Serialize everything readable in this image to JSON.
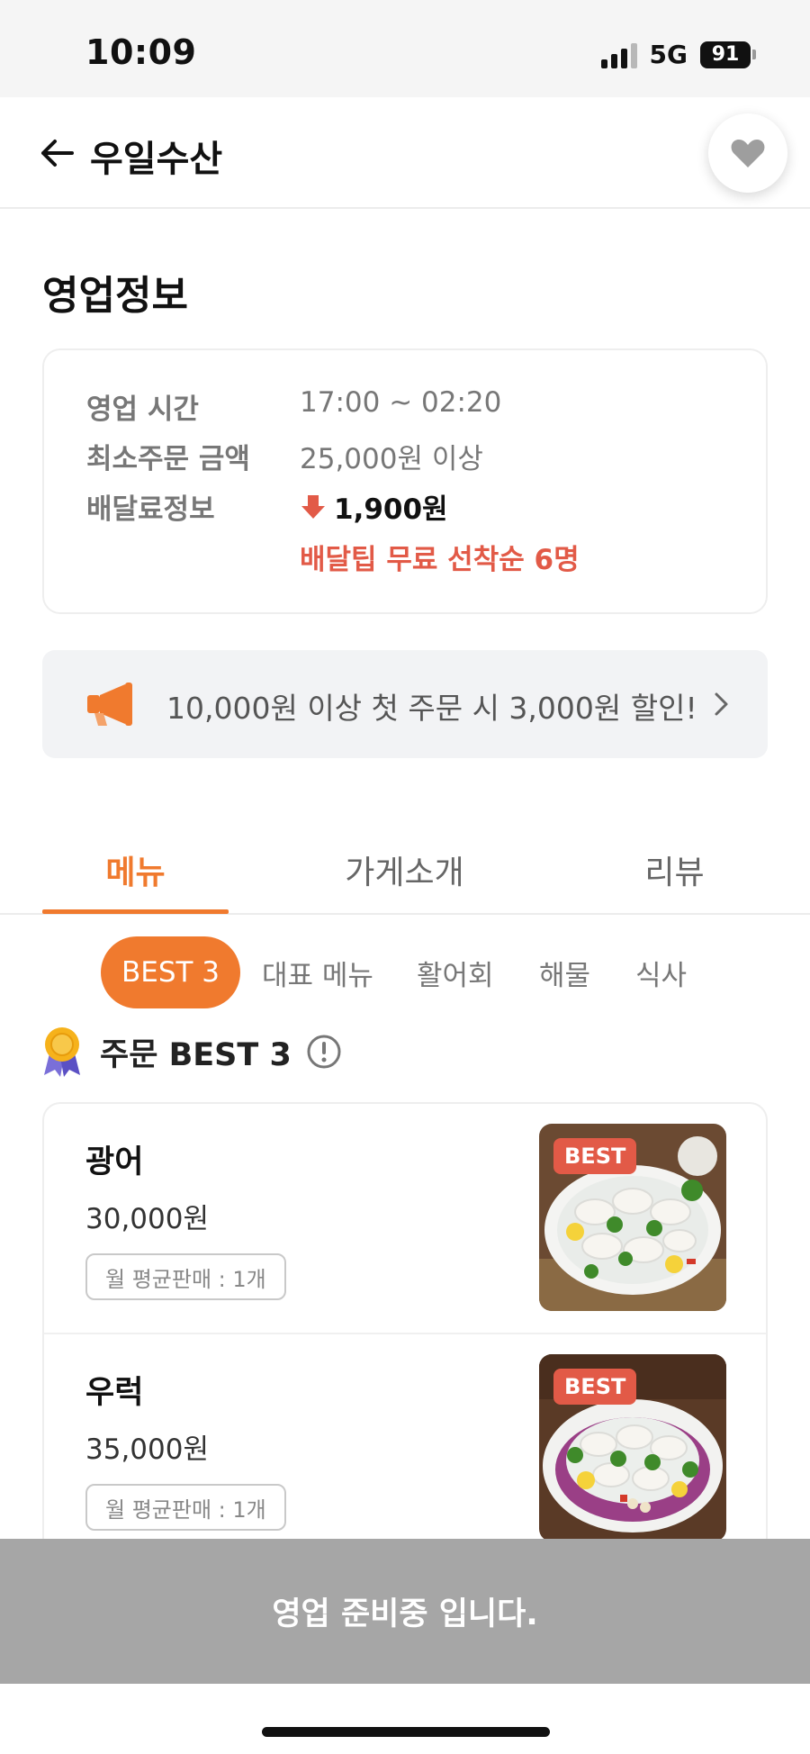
{
  "status_bar": {
    "time": "10:09",
    "network": "5G",
    "battery": "91"
  },
  "header": {
    "store_name": "우일수산"
  },
  "business_info": {
    "title": "영업정보",
    "hours_label": "영업 시간",
    "hours_value": "17:00 ~ 02:20",
    "min_order_label": "최소주문 금액",
    "min_order_value": "25,000원 이상",
    "delivery_fee_label": "배달료정보",
    "delivery_fee_value": "1,900원",
    "free_delivery_text": "배달팁 무료 선착순 6명"
  },
  "promo": {
    "text": "10,000원 이상 첫 주문 시 3,000원 할인!"
  },
  "tabs": [
    {
      "label": "메뉴",
      "active": true
    },
    {
      "label": "가게소개",
      "active": false
    },
    {
      "label": "리뷰",
      "active": false
    }
  ],
  "categories": [
    {
      "label": "BEST 3",
      "active": true
    },
    {
      "label": "대표 메뉴",
      "active": false
    },
    {
      "label": "활어회",
      "active": false
    },
    {
      "label": "해물",
      "active": false
    },
    {
      "label": "식사",
      "active": false
    }
  ],
  "best_section": {
    "title": "주문 BEST 3"
  },
  "menu_items": [
    {
      "name": "광어",
      "price": "30,000원",
      "sales": "월 평균판매 : 1개",
      "tag": "BEST"
    },
    {
      "name": "우럭",
      "price": "35,000원",
      "sales": "월 평균판매 : 1개",
      "tag": "BEST"
    }
  ],
  "closed_bar": {
    "text": "영업 준비중 입니다."
  },
  "colors": {
    "accent": "#f07a2e",
    "highlight_red": "#e25a47",
    "closed_bar": "#a6a6a6"
  }
}
